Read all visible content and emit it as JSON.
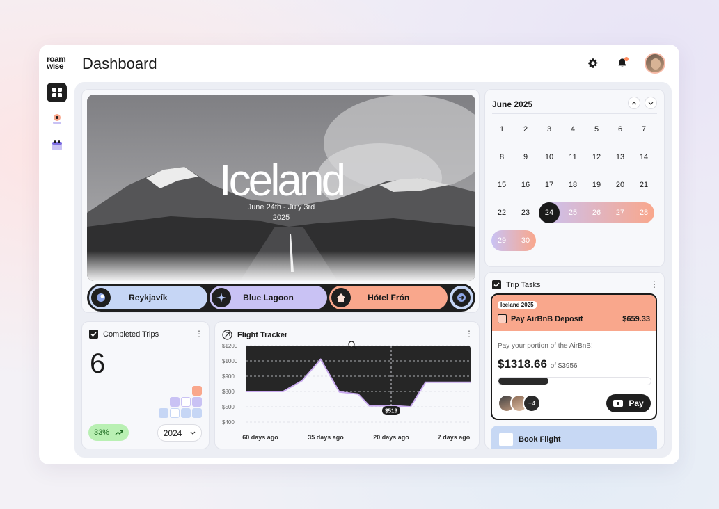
{
  "app": {
    "logo": "roam wise",
    "title": "Dashboard"
  },
  "header": {
    "icons": [
      "gear-icon",
      "bell-icon",
      "avatar"
    ]
  },
  "sidenav": {
    "items": [
      "grid-icon",
      "map-pin-icon",
      "calendar-icon"
    ]
  },
  "hero": {
    "title": "Iceland",
    "dates": "June 24th - July 3rd",
    "year": "2025",
    "stops": [
      {
        "label": "Reykjavík",
        "icon": "globe-pin-icon",
        "color": "#c6d6f5"
      },
      {
        "label": "Blue Lagoon",
        "icon": "sparkle-icon",
        "color": "#c9c2f4"
      },
      {
        "label": "Hótel Frón",
        "icon": "home-icon",
        "color": "#f9a78c"
      }
    ],
    "next_icon": "arrow-right-icon"
  },
  "completed_trips": {
    "title": "Completed Trips",
    "count": "6",
    "change": "33%",
    "year": "2024"
  },
  "flight_tracker": {
    "title": "Flight Tracker",
    "current_price_label": "$519"
  },
  "chart_data": {
    "type": "line",
    "x": [
      60,
      50,
      45,
      40,
      35,
      30,
      27,
      24,
      20,
      16,
      12,
      8,
      4,
      0
    ],
    "x_tick_labels": [
      "60 days ago",
      "35 days ago",
      "20 days ago",
      "7 days ago"
    ],
    "values": [
      800,
      800,
      870,
      1020,
      790,
      750,
      519,
      519,
      519,
      500,
      860,
      860,
      860,
      860
    ],
    "y_tick_labels": [
      "$1200",
      "$1000",
      "$900",
      "$800",
      "$500",
      "$400"
    ],
    "annotation": "$519",
    "line_color": "#c8a9ee",
    "area_color": "#262626"
  },
  "calendar": {
    "month": "June 2025",
    "weeks": [
      [
        "1",
        "2",
        "3",
        "4",
        "5",
        "6",
        "7"
      ],
      [
        "8",
        "9",
        "10",
        "11",
        "12",
        "13",
        "14"
      ],
      [
        "15",
        "16",
        "17",
        "18",
        "19",
        "20",
        "21"
      ],
      [
        "22",
        "23",
        "24",
        "25",
        "26",
        "27",
        "28"
      ],
      [
        "29",
        "30",
        "",
        "",
        "",
        "",
        ""
      ]
    ],
    "selected": "24",
    "range_start_color": "#c9c2f4",
    "range_end_color": "#f9a78c"
  },
  "trip_tasks": {
    "title": "Trip Tasks",
    "task": {
      "tag": "Iceland 2025",
      "title": "Pay AirBnB Deposit",
      "amount": "$659.33",
      "description": "Pay your portion of the AirBnB!",
      "paid": "$1318.66",
      "of_total": "of $3956",
      "progress": 0.33,
      "more_people": "+4",
      "pay_label": "Pay"
    },
    "next_task": "Book Flight"
  }
}
